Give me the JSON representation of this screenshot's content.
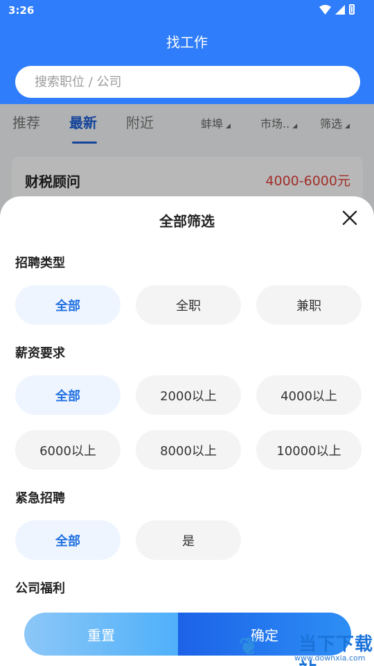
{
  "status_bar": {
    "time": "3:26"
  },
  "header": {
    "title": "找工作"
  },
  "search": {
    "placeholder": "搜索职位 / 公司"
  },
  "tabs": [
    {
      "label": "推荐",
      "active": false
    },
    {
      "label": "最新",
      "active": true
    },
    {
      "label": "附近",
      "active": false
    }
  ],
  "filters": [
    {
      "label": "蚌埠"
    },
    {
      "label": "市场.."
    },
    {
      "label": "筛选"
    }
  ],
  "job_card": {
    "title": "财税顾问",
    "salary": "4000-6000元"
  },
  "sheet": {
    "title": "全部筛选",
    "sections": {
      "recruit_type": {
        "label": "招聘类型",
        "options": [
          "全部",
          "全职",
          "兼职"
        ],
        "selected": "全部"
      },
      "salary": {
        "label": "薪资要求",
        "options": [
          "全部",
          "2000以上",
          "4000以上",
          "6000以上",
          "8000以上",
          "10000以上"
        ],
        "selected": "全部"
      },
      "urgent": {
        "label": "紧急招聘",
        "options": [
          "全部",
          "是"
        ],
        "selected": "全部"
      },
      "welfare": {
        "label": "公司福利"
      }
    },
    "reset_label": "重置",
    "confirm_label": "确定"
  },
  "watermark": {
    "text": "当下下载站",
    "url": "www.downxia.com"
  },
  "colors": {
    "primary": "#2f7dfa",
    "accent_text": "#1e6fe0",
    "salary": "#e0423a"
  }
}
